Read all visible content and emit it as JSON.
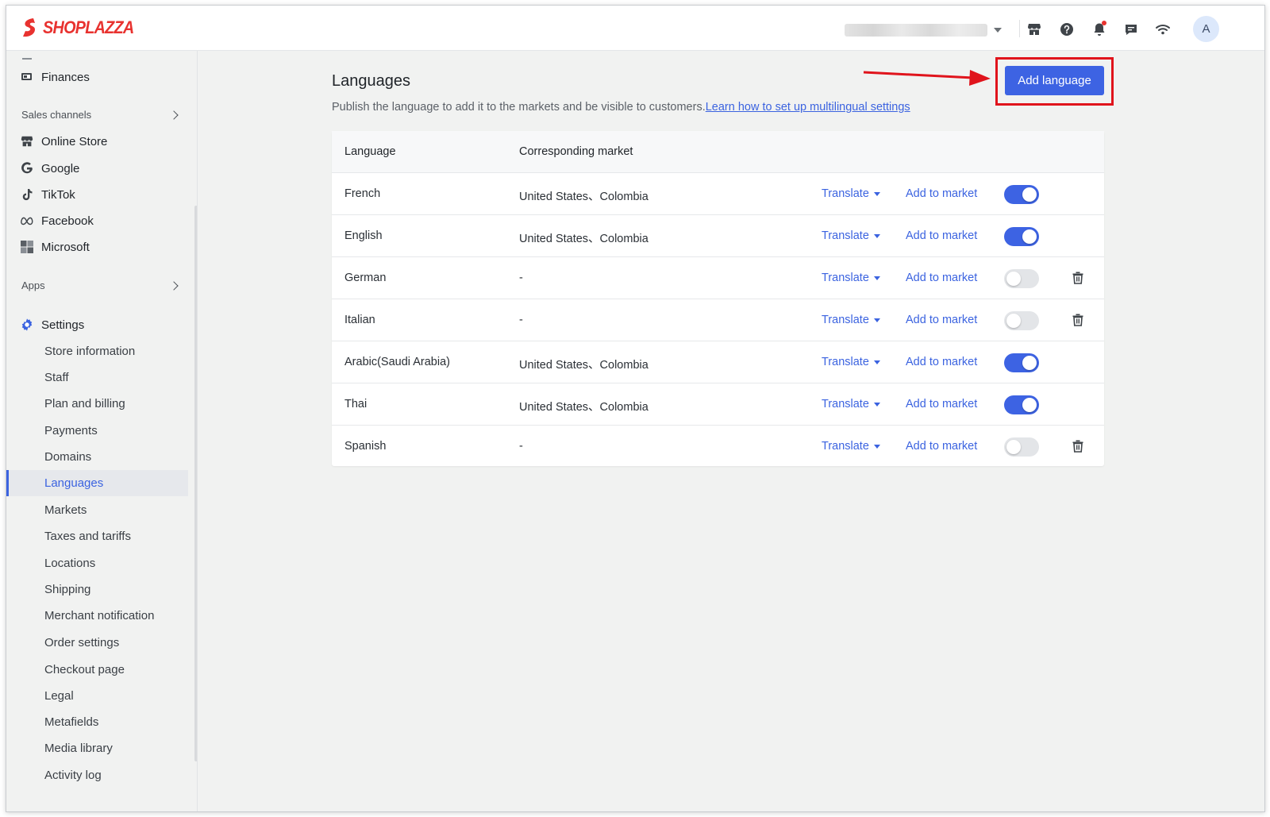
{
  "brand": {
    "name": "SHOPLAZZA",
    "color": "#e8322f"
  },
  "topbar": {
    "icons": [
      "store-icon",
      "help-icon",
      "bell-icon",
      "chat-icon",
      "wifi-icon"
    ],
    "avatar_initial": "A"
  },
  "sidebar": {
    "top_items": [
      {
        "label": "Finances",
        "icon": "finances-icon"
      }
    ],
    "sales_channels_label": "Sales channels",
    "sales_channels": [
      {
        "label": "Online Store",
        "icon": "store-icon"
      },
      {
        "label": "Google",
        "icon": "google-icon"
      },
      {
        "label": "TikTok",
        "icon": "tiktok-icon"
      },
      {
        "label": "Facebook",
        "icon": "meta-icon"
      },
      {
        "label": "Microsoft",
        "icon": "microsoft-icon"
      }
    ],
    "apps_label": "Apps",
    "settings_label": "Settings",
    "settings_items": [
      "Store information",
      "Staff",
      "Plan and billing",
      "Payments",
      "Domains",
      "Languages",
      "Markets",
      "Taxes and tariffs",
      "Locations",
      "Shipping",
      "Merchant notification",
      "Order settings",
      "Checkout page",
      "Legal",
      "Metafields",
      "Media library",
      "Activity log"
    ],
    "active_item": "Languages",
    "accent_color": "#3b63e0"
  },
  "main": {
    "title": "Languages",
    "description": "Publish the language to add it to the markets and be visible to customers.",
    "help_link": "Learn how to set up multilingual settings",
    "add_button": "Add language",
    "table": {
      "headers": [
        "Language",
        "Corresponding market"
      ],
      "translate_label": "Translate",
      "add_market_label": "Add to market",
      "rows": [
        {
          "language": "French",
          "market": "United States、Colombia",
          "published": true,
          "deletable": false
        },
        {
          "language": "English",
          "market": "United States、Colombia",
          "published": true,
          "deletable": false
        },
        {
          "language": "German",
          "market": "-",
          "published": false,
          "deletable": true
        },
        {
          "language": "Italian",
          "market": "-",
          "published": false,
          "deletable": true
        },
        {
          "language": "Arabic(Saudi Arabia)",
          "market": "United States、Colombia",
          "published": true,
          "deletable": false
        },
        {
          "language": "Thai",
          "market": "United States、Colombia",
          "published": true,
          "deletable": false
        },
        {
          "language": "Spanish",
          "market": "-",
          "published": false,
          "deletable": true
        }
      ]
    }
  }
}
